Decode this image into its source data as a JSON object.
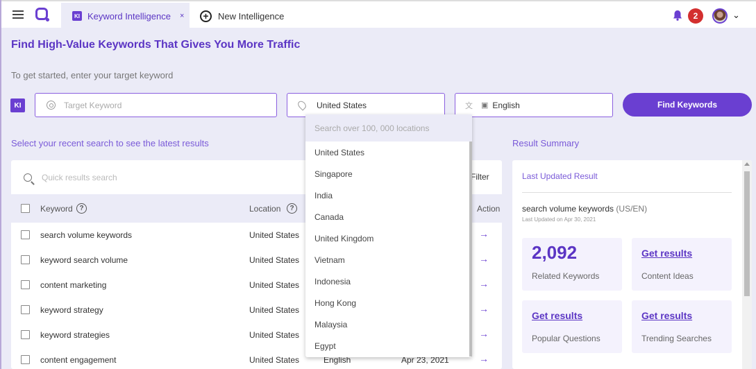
{
  "topbar": {
    "active_tab": {
      "badge": "KI",
      "label": "Keyword Intelligence",
      "close": "×"
    },
    "new_tab": {
      "icon": "+",
      "label": "New Intelligence"
    },
    "notification_count": "2",
    "chevron": "⌄"
  },
  "header": {
    "title": "Find High-Value Keywords That Gives You More Traffic",
    "subtitle": "To get started, enter your target keyword"
  },
  "search": {
    "badge": "KI",
    "keyword_placeholder": "Target Keyword",
    "keyword_value": "",
    "location_value": "United States",
    "language_value": "English",
    "find_button": "Find Keywords"
  },
  "location_dropdown": {
    "search_placeholder": "Search over 100, 000 locations",
    "options": [
      "United States",
      "Singapore",
      "India",
      "Canada",
      "United Kingdom",
      "Vietnam",
      "Indonesia",
      "Hong Kong",
      "Malaysia",
      "Egypt"
    ]
  },
  "recent": {
    "section_title": "Select your recent search to see the latest results",
    "search_placeholder": "Quick results search",
    "filter_label": "Filter",
    "columns": {
      "keyword": "Keyword",
      "location": "Location",
      "action": "Action"
    },
    "rows": [
      {
        "keyword": "search volume keywords",
        "location": "United States",
        "language": "",
        "date": ""
      },
      {
        "keyword": "keyword search volume",
        "location": "United States",
        "language": "",
        "date": ""
      },
      {
        "keyword": "content marketing",
        "location": "United States",
        "language": "",
        "date": ""
      },
      {
        "keyword": "keyword strategy",
        "location": "United States",
        "language": "",
        "date": ""
      },
      {
        "keyword": "keyword strategies",
        "location": "United States",
        "language": "",
        "date": ""
      },
      {
        "keyword": "content engagement",
        "location": "United States",
        "language": "English",
        "date": "Apr 23, 2021"
      }
    ],
    "action_icon": "→"
  },
  "summary": {
    "section_title": "Result Summary",
    "last_updated_label": "Last Updated Result",
    "keyword": "search volume keywords",
    "locale_tag": "(US/EN)",
    "updated_on": "Last Updated on Apr 30, 2021",
    "tiles": [
      {
        "value": "2,092",
        "label": "Related Keywords"
      },
      {
        "value": "Get results",
        "label": "Content Ideas"
      },
      {
        "value": "Get results",
        "label": "Popular Questions"
      },
      {
        "value": "Get results",
        "label": "Trending Searches"
      }
    ]
  },
  "colors": {
    "accent": "#6a3fd1",
    "badge_red": "#d32f2f",
    "background": "#ebebf7"
  }
}
